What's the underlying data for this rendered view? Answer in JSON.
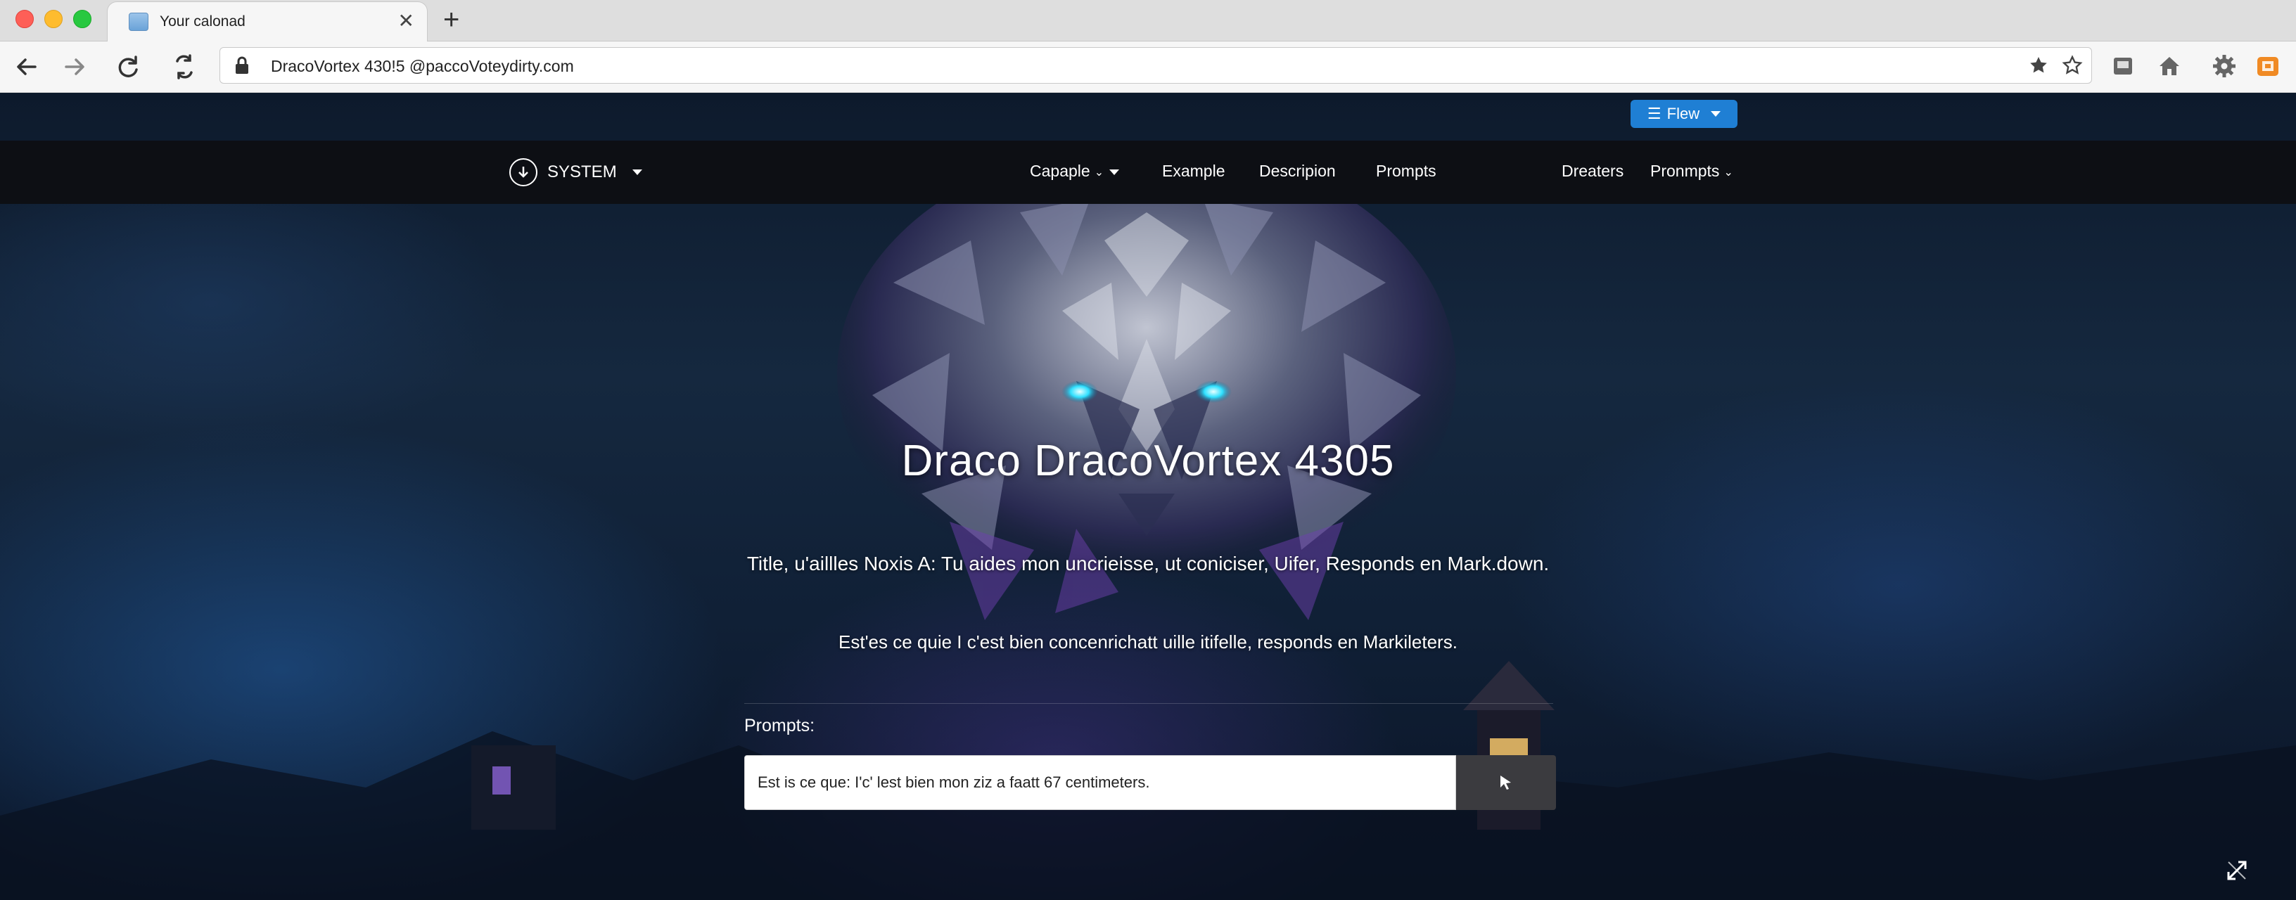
{
  "browser": {
    "tab_title": "Your calonad",
    "url": "DracoVortex 430!5 @paccoVoteydirty.com"
  },
  "site": {
    "flew_button": "Flew",
    "brand": "SYSTEM",
    "nav": {
      "capaple": "Capaple",
      "example": "Example",
      "descripion": "Descripion",
      "prompts": "Prompts",
      "dreaters": "Dreaters",
      "prompts_menu": "Pronmpts"
    }
  },
  "hero": {
    "title": "Draco  DracoVortex 4305",
    "subtitle": "Title, u'aillles Noxis A: Tu aides mon uncrieisse, ut coniciser, Uifer, Responds en Mark.down.",
    "subtitle2": "Est'es ce quie I c'est bien concenrichatt uille  itifelle, responds en Markileters."
  },
  "prompt": {
    "label": "Prompts:",
    "value": "Est is ce que: I'c' lest bien mon ziz a faatt 67 centimeters."
  },
  "colors": {
    "accent": "#1f7fd4",
    "navbar": "#0d0f14",
    "send_button": "#3b3b3f"
  },
  "icons": [
    "back-icon",
    "forward-icon",
    "reload-icon",
    "extension-icon",
    "lock-icon",
    "star-icon",
    "bookmark-star-icon",
    "download-icon",
    "home-icon",
    "gear-icon",
    "extension-orange-icon",
    "download-circle-icon",
    "cursor-icon",
    "fullscreen-icon"
  ]
}
